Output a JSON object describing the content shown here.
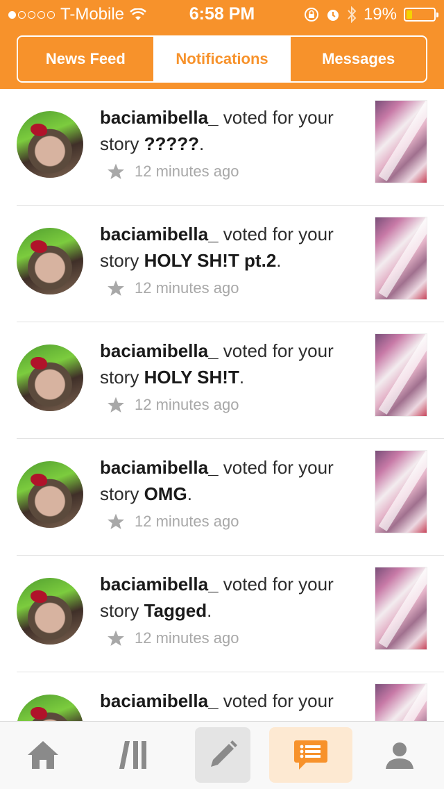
{
  "status_bar": {
    "carrier": "T-Mobile",
    "time": "6:58 PM",
    "battery": "19%",
    "battery_level": 0.19
  },
  "tabs": [
    {
      "label": "News Feed",
      "active": false
    },
    {
      "label": "Notifications",
      "active": true
    },
    {
      "label": "Messages",
      "active": false
    }
  ],
  "notifications": [
    {
      "user": "baciamibella_",
      "action": " voted for your story ",
      "story": "?????",
      "time": "12 minutes ago"
    },
    {
      "user": "baciamibella_",
      "action": " voted for your story ",
      "story": "HOLY SH!T pt.2",
      "time": "12 minutes ago"
    },
    {
      "user": "baciamibella_",
      "action": " voted for your story ",
      "story": "HOLY SH!T",
      "time": "12 minutes ago"
    },
    {
      "user": "baciamibella_",
      "action": " voted for your story ",
      "story": "OMG",
      "time": "12 minutes ago"
    },
    {
      "user": "baciamibella_",
      "action": " voted for your story ",
      "story": "Tagged",
      "time": "12 minutes ago"
    },
    {
      "user": "baciamibella_",
      "action": " voted for your ",
      "story": "",
      "time": ""
    }
  ],
  "bottom_nav": [
    {
      "icon": "home-icon"
    },
    {
      "icon": "library-icon"
    },
    {
      "icon": "write-icon"
    },
    {
      "icon": "notifications-icon",
      "active": true
    },
    {
      "icon": "profile-icon"
    }
  ],
  "colors": {
    "accent": "#f7922b",
    "text": "#2d2d2d",
    "muted": "#a8a8a8"
  }
}
